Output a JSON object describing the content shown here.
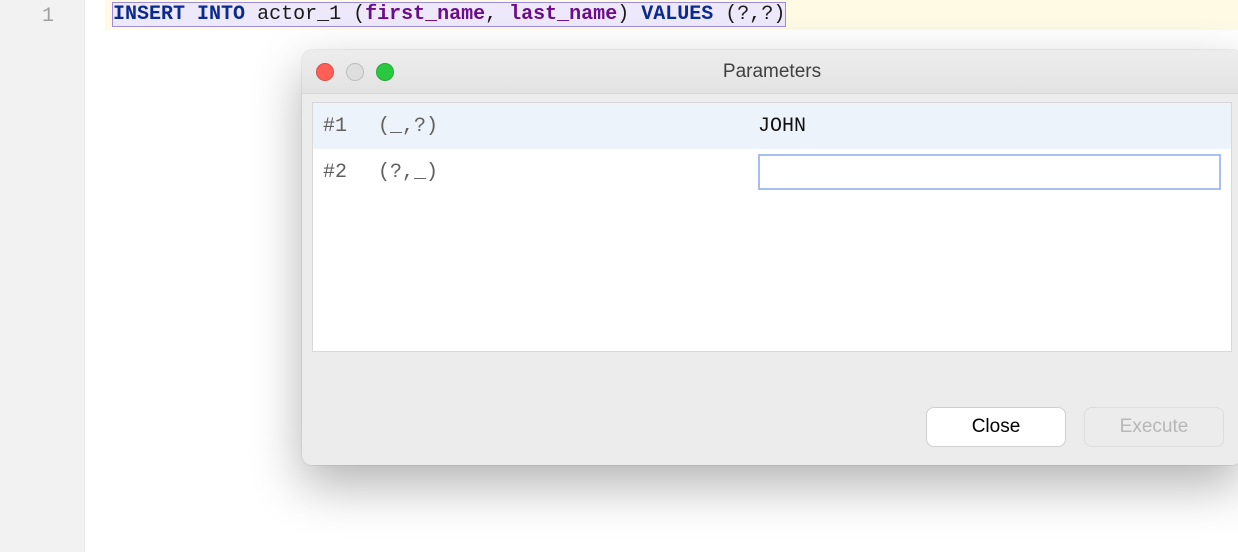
{
  "editor": {
    "line_number": "1",
    "tokens": {
      "insert": "INSERT",
      "into": "INTO",
      "table": "actor_1",
      "lp1": "(",
      "col1": "first_name",
      "comma1": ",",
      "col2": "last_name",
      "rp1": ")",
      "values_kw": "VALUES",
      "lp2": "(",
      "q1": "?",
      "comma2": ",",
      "q2": "?",
      "rp2": ")"
    }
  },
  "dialog": {
    "title": "Parameters",
    "params": [
      {
        "num": "#1",
        "hint": "(_,?)",
        "value": "JOHN",
        "editing": false
      },
      {
        "num": "#2",
        "hint": "(?,_)",
        "value": "",
        "editing": true
      }
    ],
    "buttons": {
      "close": "Close",
      "execute": "Execute"
    }
  }
}
